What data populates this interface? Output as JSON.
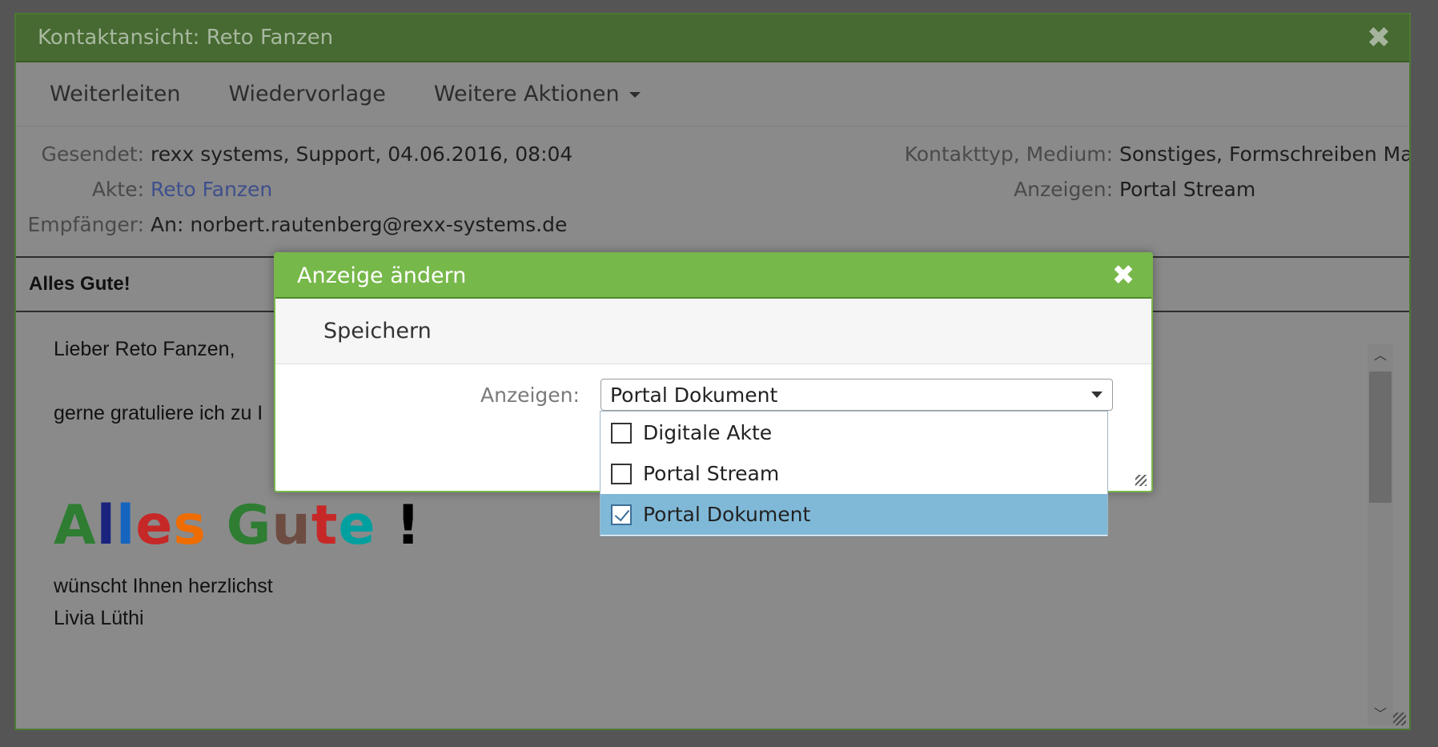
{
  "window": {
    "title": "Kontaktansicht: Reto Fanzen",
    "toolbar": {
      "forward": "Weiterleiten",
      "resubmission": "Wiedervorlage",
      "more_actions": "Weitere Aktionen"
    },
    "meta": {
      "sent_label": "Gesendet:",
      "sent_value": "rexx systems, Support, 04.06.2016, 08:04",
      "file_label": "Akte:",
      "file_value": "Reto Fanzen",
      "recipient_label": "Empfänger:",
      "recipient_value": "An: norbert.rautenberg@rexx-systems.de",
      "contact_type_label": "Kontakttyp, Medium:",
      "contact_type_value": "Sonstiges, Formschreiben Mail",
      "display_label": "Anzeigen:",
      "display_value": "Portal Stream"
    },
    "subject": "Alles Gute!",
    "body": {
      "greeting": "Lieber Reto Fanzen,",
      "line1": "gerne gratuliere ich zu I",
      "line2": "wünscht Ihnen herzlichst",
      "signature": "Livia Lüthi",
      "big_letters": [
        {
          "char": "A",
          "color": "#2e7d32"
        },
        {
          "char": "l",
          "color": "#1a237e"
        },
        {
          "char": "l",
          "color": "#1565c0"
        },
        {
          "char": "e",
          "color": "#c62828"
        },
        {
          "char": "s",
          "color": "#ef6c00"
        },
        {
          "char": " ",
          "color": "#000000"
        },
        {
          "char": "G",
          "color": "#2e7d32"
        },
        {
          "char": "u",
          "color": "#6d4c41"
        },
        {
          "char": "t",
          "color": "#c62828"
        },
        {
          "char": "e",
          "color": "#00a0a0"
        },
        {
          "char": " ",
          "color": "#000000"
        },
        {
          "char": "!",
          "color": "#000000"
        }
      ]
    }
  },
  "modal": {
    "title": "Anzeige ändern",
    "save_label": "Speichern",
    "field_label": "Anzeigen:",
    "select_value": "Portal Dokument",
    "options": [
      {
        "label": "Digitale Akte",
        "checked": false
      },
      {
        "label": "Portal Stream",
        "checked": false
      },
      {
        "label": "Portal Dokument",
        "checked": true
      }
    ]
  },
  "icons": {
    "close": "close-icon",
    "caret": "caret-down-icon"
  },
  "colors": {
    "dialog_green": "#77b84a",
    "window_green": "#466a31",
    "selected_option": "#80b9d8",
    "link": "#3e4f8c"
  }
}
